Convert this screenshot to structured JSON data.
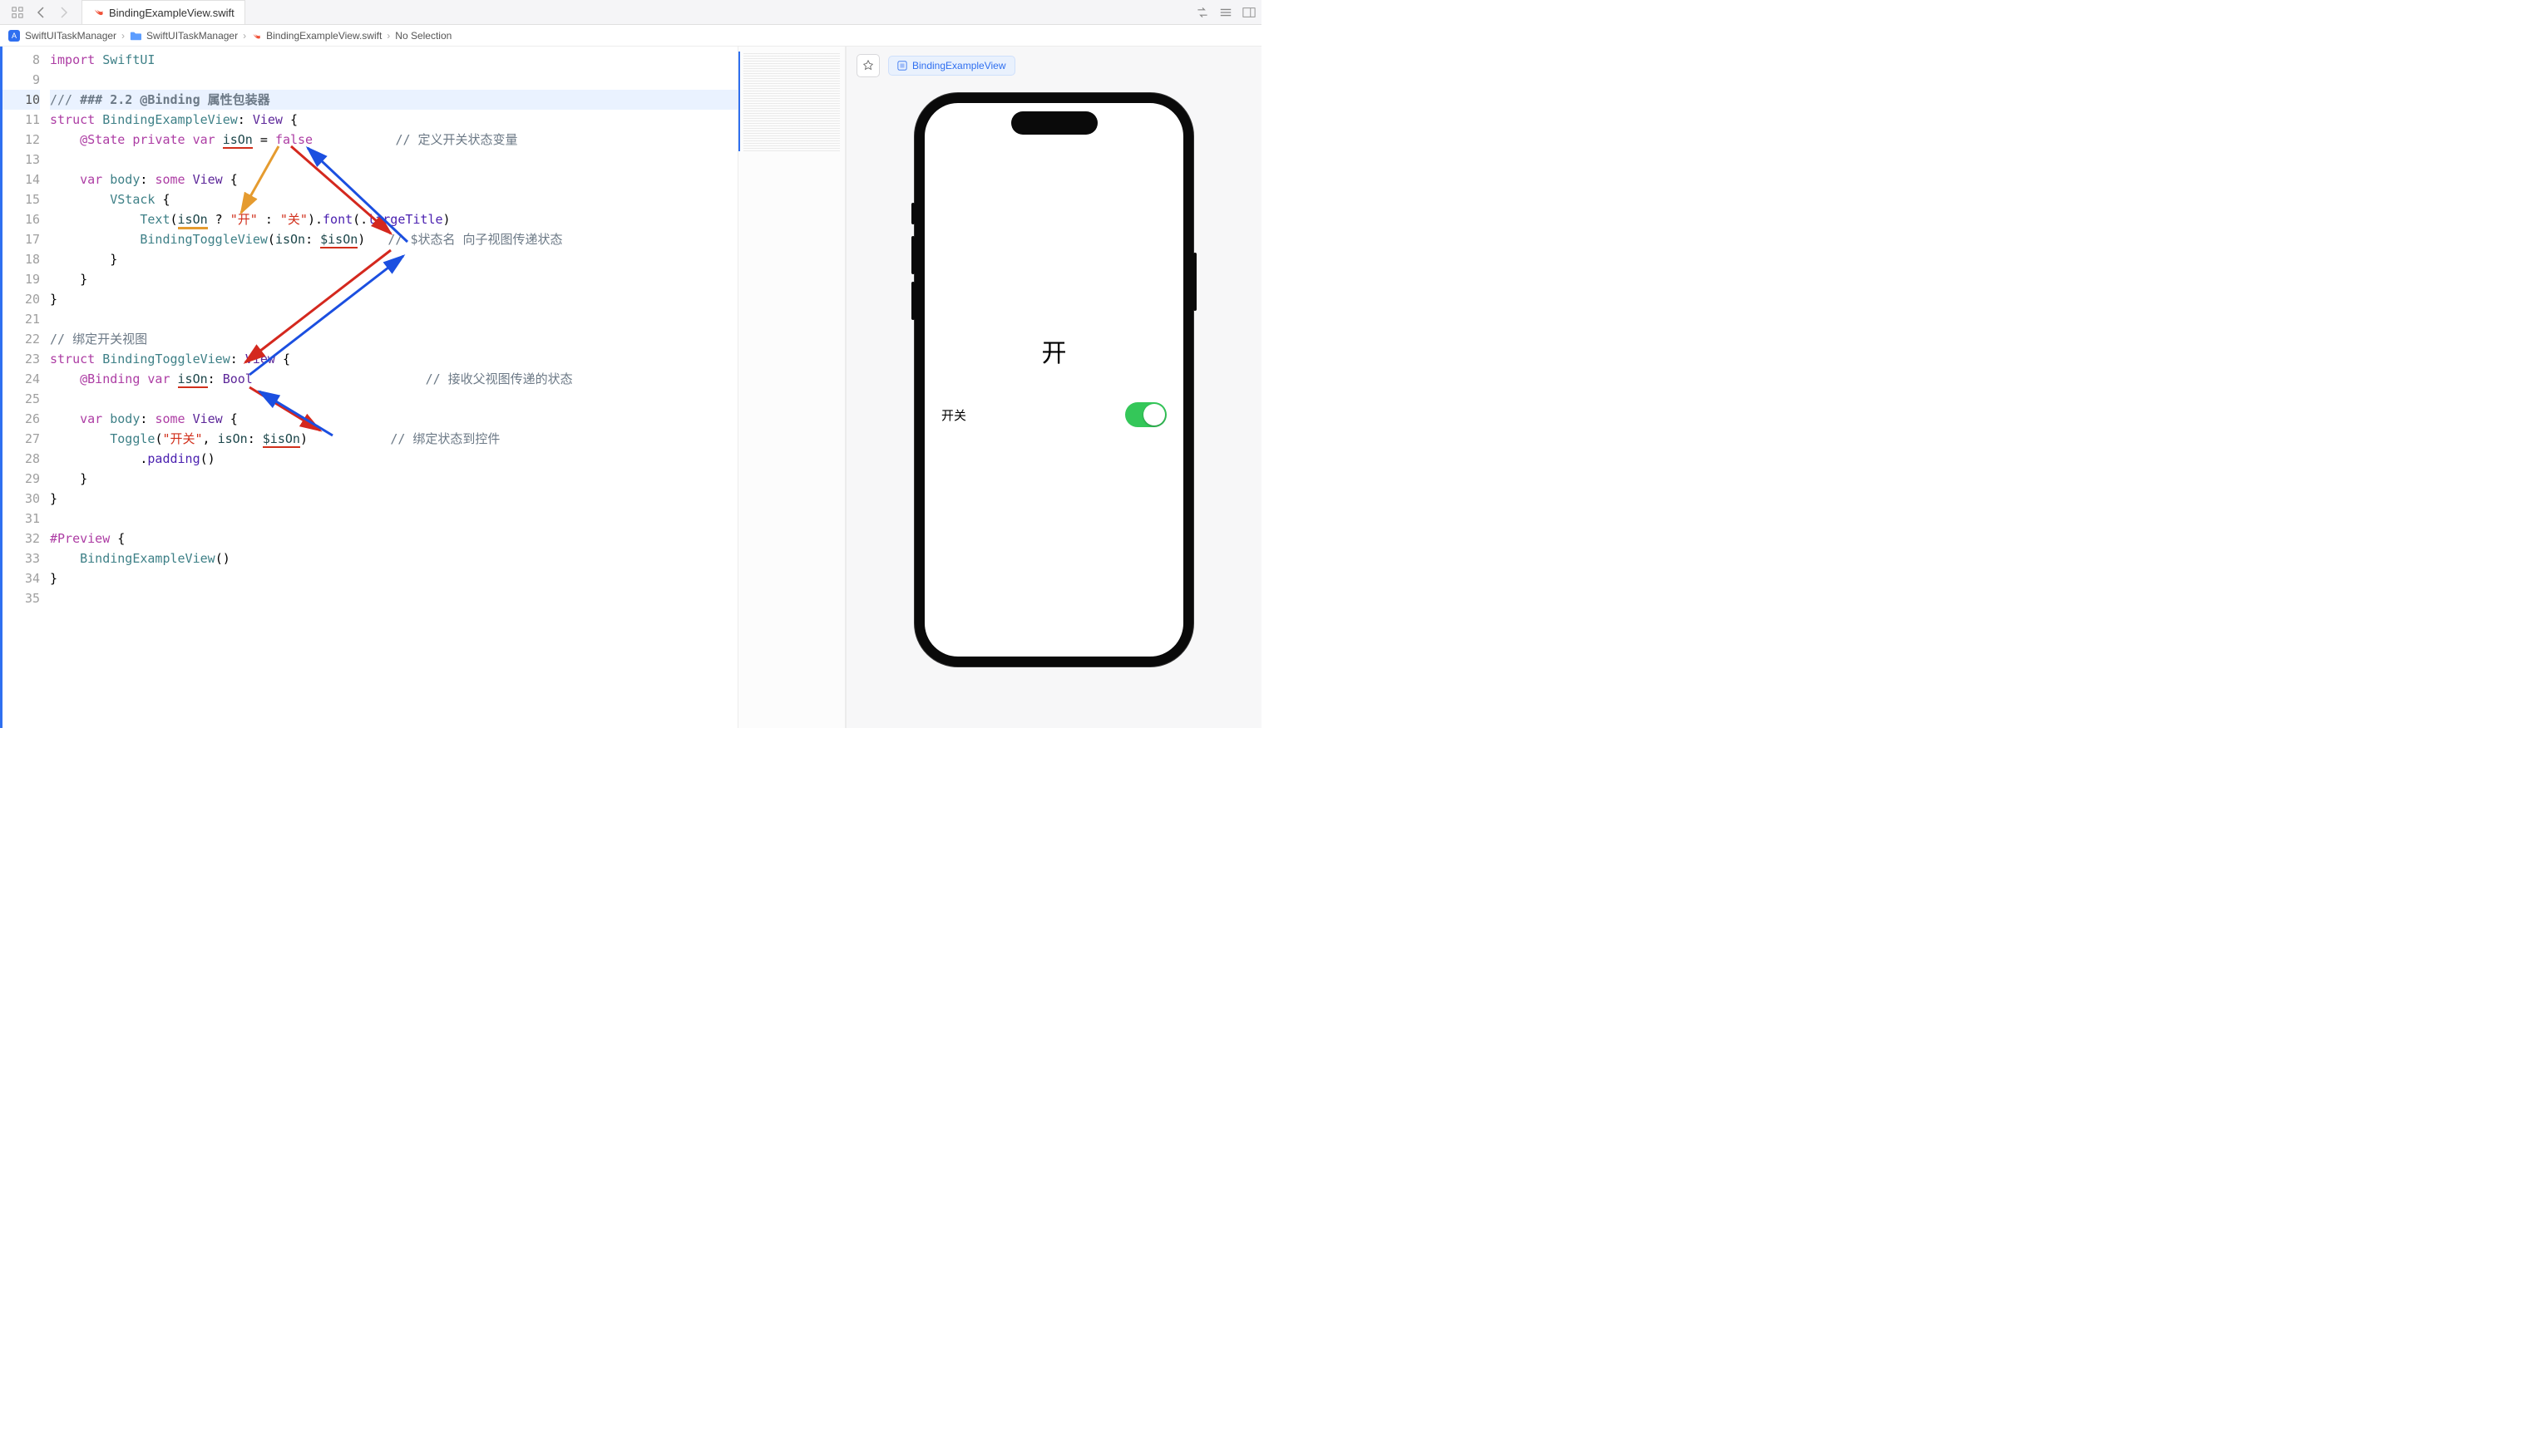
{
  "tab": {
    "filename": "BindingExampleView.swift"
  },
  "breadcrumb": {
    "project": "SwiftUITaskManager",
    "folder": "SwiftUITaskManager",
    "file": "BindingExampleView.swift",
    "selection": "No Selection"
  },
  "gutter": {
    "start": 8,
    "end": 35
  },
  "code": {
    "lines": [
      {
        "n": 8,
        "tokens": [
          [
            "kw",
            "import"
          ],
          [
            "op",
            " "
          ],
          [
            "type",
            "SwiftUI"
          ]
        ]
      },
      {
        "n": 9,
        "tokens": []
      },
      {
        "n": 10,
        "hl": true,
        "tokens": [
          [
            "comm",
            "/// "
          ],
          [
            "comm-b",
            "### 2.2 @Binding 属性包装器"
          ]
        ]
      },
      {
        "n": 11,
        "tokens": [
          [
            "kw",
            "struct"
          ],
          [
            "op",
            " "
          ],
          [
            "decl",
            "BindingExampleView"
          ],
          [
            "op",
            ": "
          ],
          [
            "type2",
            "View"
          ],
          [
            "op",
            " {"
          ]
        ]
      },
      {
        "n": 12,
        "tokens": [
          [
            "op",
            "    "
          ],
          [
            "attr",
            "@State"
          ],
          [
            "op",
            " "
          ],
          [
            "kw",
            "private"
          ],
          [
            "op",
            " "
          ],
          [
            "kw",
            "var"
          ],
          [
            "op",
            " "
          ],
          [
            "id state",
            "isOn"
          ],
          [
            "op",
            " = "
          ],
          [
            "kw",
            "false"
          ],
          [
            "op",
            "           "
          ],
          [
            "comm",
            "// 定义开关状态变量"
          ]
        ]
      },
      {
        "n": 13,
        "tokens": []
      },
      {
        "n": 14,
        "tokens": [
          [
            "op",
            "    "
          ],
          [
            "kw",
            "var"
          ],
          [
            "op",
            " "
          ],
          [
            "decl",
            "body"
          ],
          [
            "op",
            ": "
          ],
          [
            "kw",
            "some"
          ],
          [
            "op",
            " "
          ],
          [
            "type2",
            "View"
          ],
          [
            "op",
            " {"
          ]
        ]
      },
      {
        "n": 15,
        "tokens": [
          [
            "op",
            "        "
          ],
          [
            "type",
            "VStack"
          ],
          [
            "op",
            " {"
          ]
        ]
      },
      {
        "n": 16,
        "tokens": [
          [
            "op",
            "            "
          ],
          [
            "type",
            "Text"
          ],
          [
            "op",
            "("
          ],
          [
            "id state-o",
            "isOn"
          ],
          [
            "op",
            " ? "
          ],
          [
            "str",
            "\"开\""
          ],
          [
            "op",
            " : "
          ],
          [
            "str",
            "\"关\""
          ],
          [
            "op",
            ")."
          ],
          [
            "fnname",
            "font"
          ],
          [
            "op",
            "(."
          ],
          [
            "member",
            "largeTitle"
          ],
          [
            "op",
            ")"
          ]
        ]
      },
      {
        "n": 17,
        "tokens": [
          [
            "op",
            "            "
          ],
          [
            "type",
            "BindingToggleView"
          ],
          [
            "op",
            "("
          ],
          [
            "id",
            "isOn"
          ],
          [
            "op",
            ": "
          ],
          [
            "id state",
            "$isOn"
          ],
          [
            "op",
            ")   "
          ],
          [
            "comm",
            "// $状态名 向子视图传递状态"
          ]
        ]
      },
      {
        "n": 18,
        "tokens": [
          [
            "op",
            "        }"
          ]
        ]
      },
      {
        "n": 19,
        "tokens": [
          [
            "op",
            "    }"
          ]
        ]
      },
      {
        "n": 20,
        "tokens": [
          [
            "op",
            "}"
          ]
        ]
      },
      {
        "n": 21,
        "tokens": []
      },
      {
        "n": 22,
        "tokens": [
          [
            "comm",
            "// 绑定开关视图"
          ]
        ]
      },
      {
        "n": 23,
        "tokens": [
          [
            "kw",
            "struct"
          ],
          [
            "op",
            " "
          ],
          [
            "decl",
            "BindingToggleView"
          ],
          [
            "op",
            ": "
          ],
          [
            "type2",
            "View"
          ],
          [
            "op",
            " {"
          ]
        ]
      },
      {
        "n": 24,
        "tokens": [
          [
            "op",
            "    "
          ],
          [
            "attr",
            "@Binding"
          ],
          [
            "op",
            " "
          ],
          [
            "kw",
            "var"
          ],
          [
            "op",
            " "
          ],
          [
            "id state",
            "isOn"
          ],
          [
            "op",
            ": "
          ],
          [
            "type2",
            "Bool"
          ],
          [
            "op",
            "                       "
          ],
          [
            "comm",
            "// 接收父视图传递的状态"
          ]
        ]
      },
      {
        "n": 25,
        "tokens": []
      },
      {
        "n": 26,
        "tokens": [
          [
            "op",
            "    "
          ],
          [
            "kw",
            "var"
          ],
          [
            "op",
            " "
          ],
          [
            "decl",
            "body"
          ],
          [
            "op",
            ": "
          ],
          [
            "kw",
            "some"
          ],
          [
            "op",
            " "
          ],
          [
            "type2",
            "View"
          ],
          [
            "op",
            " {"
          ]
        ]
      },
      {
        "n": 27,
        "tokens": [
          [
            "op",
            "        "
          ],
          [
            "type",
            "Toggle"
          ],
          [
            "op",
            "("
          ],
          [
            "str",
            "\"开关\""
          ],
          [
            "op",
            ", "
          ],
          [
            "id",
            "isOn"
          ],
          [
            "op",
            ": "
          ],
          [
            "id state",
            "$isOn"
          ],
          [
            "op",
            ")           "
          ],
          [
            "comm",
            "// 绑定状态到控件"
          ]
        ]
      },
      {
        "n": 28,
        "tokens": [
          [
            "op",
            "            ."
          ],
          [
            "fnname",
            "padding"
          ],
          [
            "op",
            "()"
          ]
        ]
      },
      {
        "n": 29,
        "tokens": [
          [
            "op",
            "    }"
          ]
        ]
      },
      {
        "n": 30,
        "tokens": [
          [
            "op",
            "}"
          ]
        ]
      },
      {
        "n": 31,
        "tokens": []
      },
      {
        "n": 32,
        "tokens": [
          [
            "kw",
            "#Preview"
          ],
          [
            "op",
            " {"
          ]
        ]
      },
      {
        "n": 33,
        "tokens": [
          [
            "op",
            "    "
          ],
          [
            "type",
            "BindingExampleView"
          ],
          [
            "op",
            "()"
          ]
        ]
      },
      {
        "n": 34,
        "tokens": [
          [
            "op",
            "}"
          ]
        ]
      },
      {
        "n": 35,
        "tokens": []
      }
    ]
  },
  "preview": {
    "badge": "BindingExampleView",
    "big_label": "开",
    "toggle_label": "开关",
    "toggle_on": true
  }
}
